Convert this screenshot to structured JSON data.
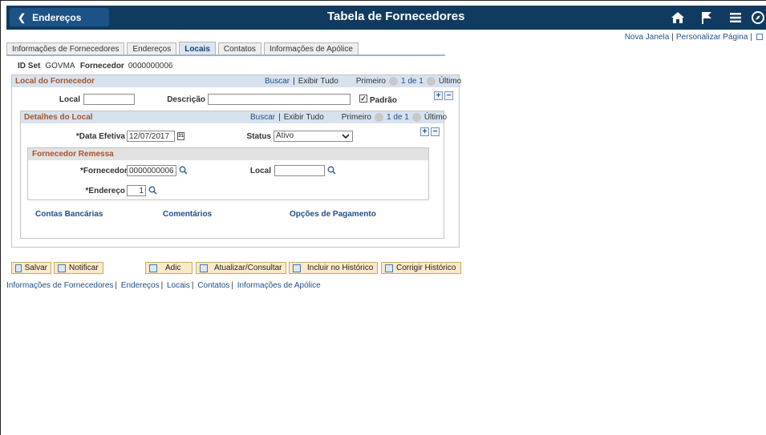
{
  "banner": {
    "back_label": "Endereços",
    "title": "Tabela de Fornecedores",
    "icons": [
      "home-icon",
      "flag-icon",
      "menu-icon",
      "compass-icon"
    ]
  },
  "toplinks": {
    "new_window": "Nova Janela",
    "personalize": "Personalizar Página"
  },
  "tabs": [
    {
      "label": "Informações de Fornecedores",
      "active": false
    },
    {
      "label": "Endereços",
      "active": false
    },
    {
      "label": "Locais",
      "active": true
    },
    {
      "label": "Contatos",
      "active": false
    },
    {
      "label": "Informações de Apólice",
      "active": false
    }
  ],
  "idset": {
    "label": "ID Set",
    "value": "GOVMA",
    "vendor_label": "Fornecedor",
    "vendor_value": "0000000006"
  },
  "local_fornecedor": {
    "title": "Local do Fornecedor",
    "find": "Buscar",
    "view_all": "Exibir Tudo",
    "first": "Primeiro",
    "count": "1 de 1",
    "last": "Último",
    "local_label": "Local",
    "local_value": "",
    "desc_label": "Descrição",
    "desc_value": "",
    "default_label": "Padrão",
    "default_checked": true
  },
  "detalhes_local": {
    "title": "Detalhes do Local",
    "find": "Buscar",
    "view_all": "Exibir Tudo",
    "first": "Primeiro",
    "count": "1 de 1",
    "last": "Último",
    "date_label": "*Data Efetiva",
    "date_value": "12/07/2017",
    "status_label": "Status",
    "status_value": "Ativo"
  },
  "fornecedor_remessa": {
    "title": "Fornecedor Remessa",
    "vendor_label": "*Fornecedor",
    "vendor_value": "0000000006",
    "local_label": "Local",
    "local_value": "",
    "address_label": "*Endereço",
    "address_value": "1"
  },
  "links": {
    "bank": "Contas Bancárias",
    "comments": "Comentários",
    "payment": "Opções de Pagamento"
  },
  "toolbar": {
    "save": "Salvar",
    "notify": "Notificar",
    "add": "Adic",
    "update": "Atualizar/Consultar",
    "include_history": "Incluir no Histórico",
    "correct_history": "Corrigir Histórico"
  },
  "bottom_links": [
    "Informações de Fornecedores",
    "Endereços",
    "Locais",
    "Contatos",
    "Informações de Apólice"
  ]
}
